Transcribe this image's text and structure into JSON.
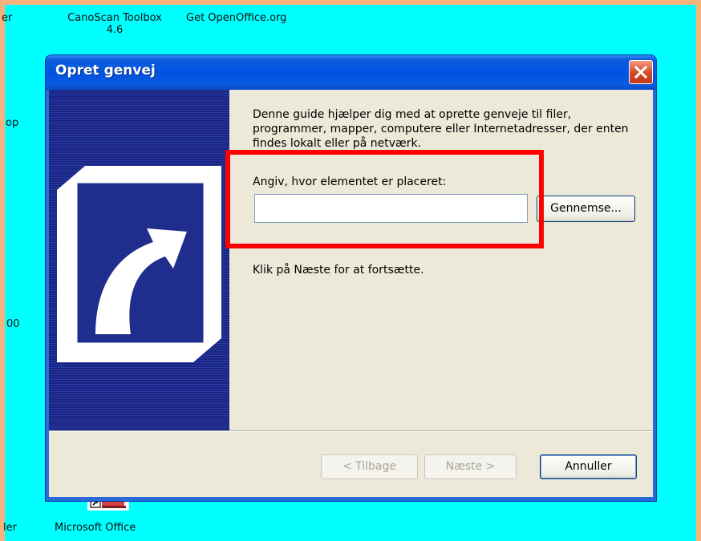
{
  "desktop": {
    "icons": [
      {
        "label_line1": "CanoScan Toolbox",
        "label_line2": "4.6"
      },
      {
        "label_line1": "Get OpenOffice.org",
        "label_line2": ""
      },
      {
        "label_line1": "Microsoft Office",
        "label_line2": ""
      }
    ],
    "edge_fragments": [
      "er",
      "op",
      "00",
      "ler"
    ]
  },
  "dialog": {
    "title": "Opret genvej",
    "intro_text": "Denne guide hjælper dig med at oprette genveje til filer, programmer, mapper, computere eller Internetadresser, der enten findes lokalt eller på netværk.",
    "field_label": "Angiv, hvor elementet er placeret:",
    "location_value": "",
    "browse_label": "Gennemse...",
    "continue_text": "Klik på Næste for at fortsætte.",
    "buttons": {
      "back": "< Tilbage",
      "next": "Næste >",
      "cancel": "Annuller"
    }
  },
  "icons": {
    "close": "close-x-icon",
    "wizard_art": "shortcut-arrow-icon"
  },
  "colors": {
    "desktop": "#00ffff",
    "outer_border": "#f8b27c",
    "titlebar": "#0054e3",
    "dialog_face": "#ece9d8",
    "side_panel": "#1f2d8c",
    "highlight": "#ff0000"
  }
}
